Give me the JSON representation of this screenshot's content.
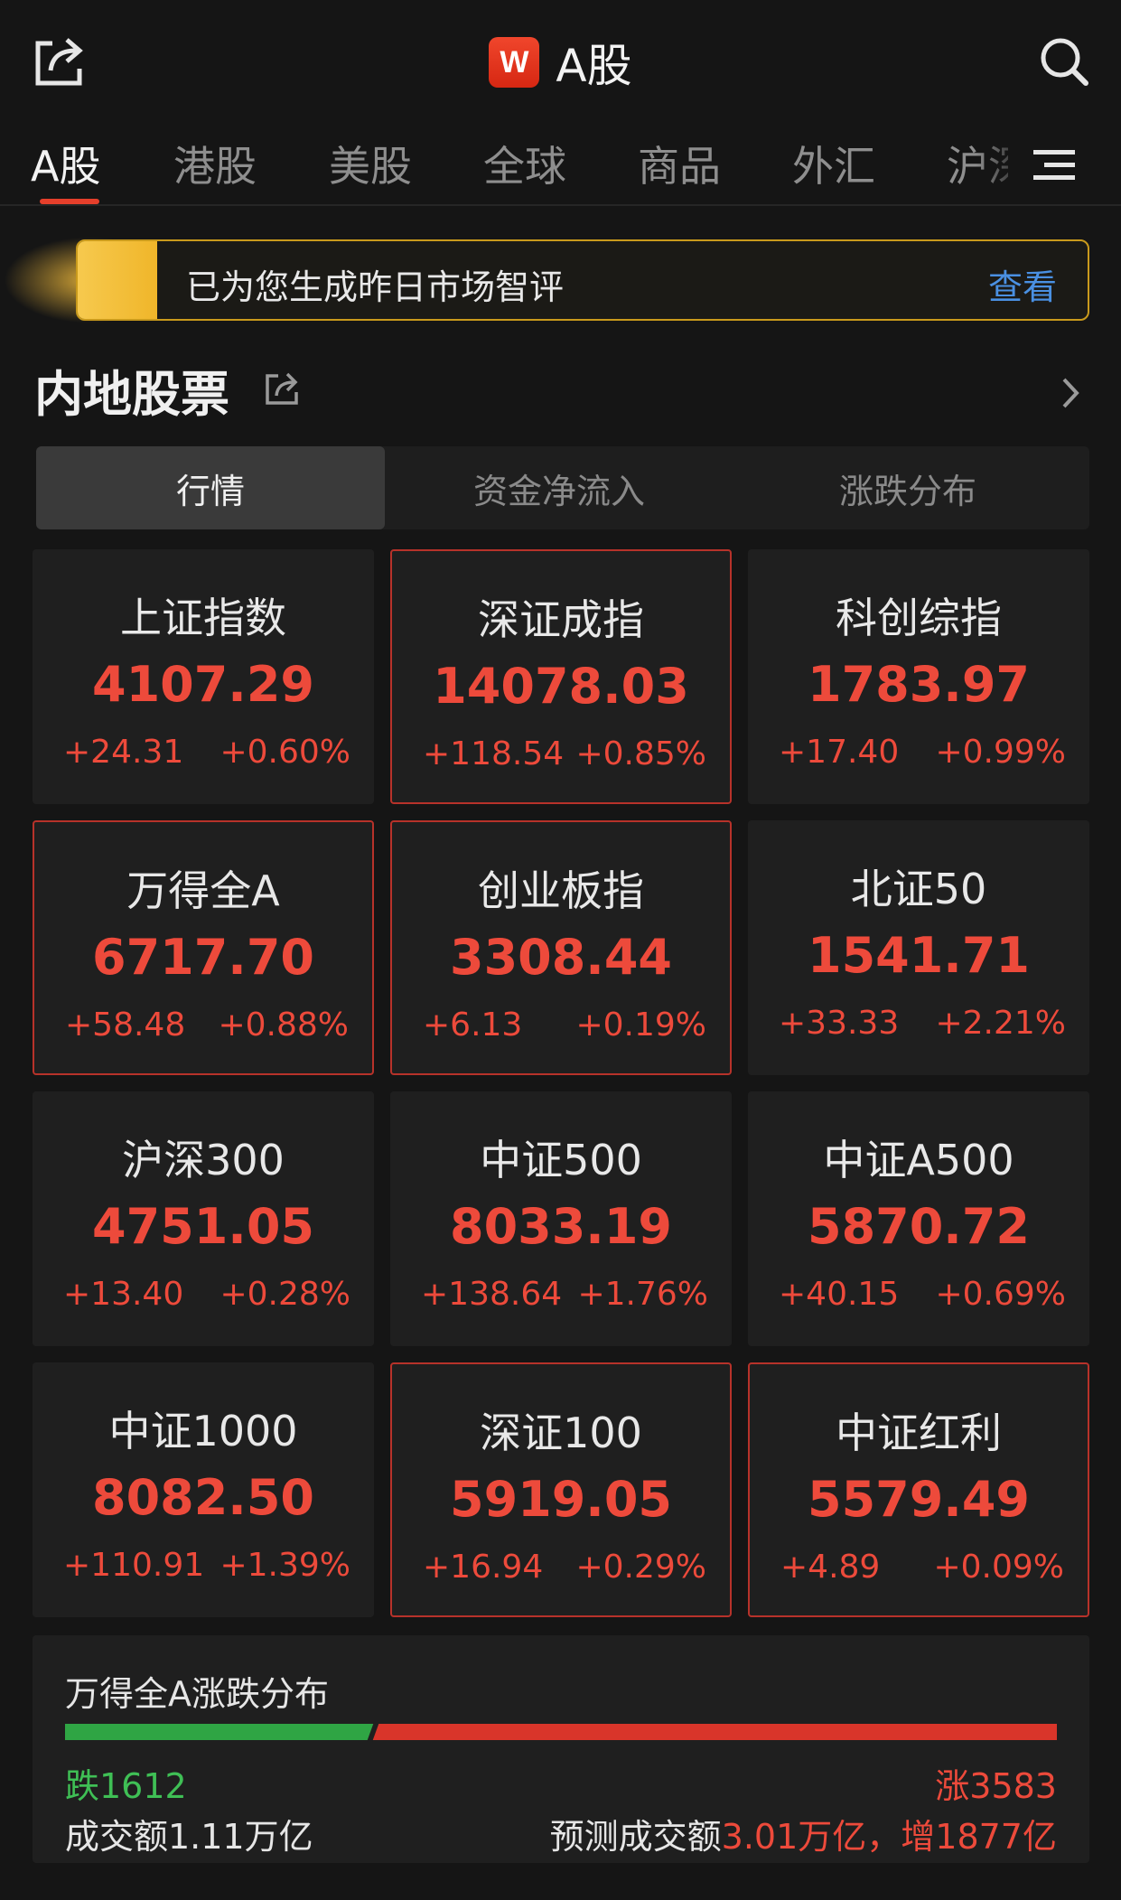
{
  "header": {
    "logo_letter": "W",
    "title": "A股",
    "icons": [
      "share-icon",
      "search-icon",
      "menu-icon"
    ]
  },
  "tabs": [
    {
      "label": "A股",
      "active": true
    },
    {
      "label": "港股",
      "active": false
    },
    {
      "label": "美股",
      "active": false
    },
    {
      "label": "全球",
      "active": false
    },
    {
      "label": "商品",
      "active": false
    },
    {
      "label": "外汇",
      "active": false
    },
    {
      "label": "沪深",
      "active": false
    }
  ],
  "banner": {
    "text": "已为您生成昨日市场智评",
    "link": "查看"
  },
  "section": {
    "title": "内地股票"
  },
  "subtabs": [
    {
      "label": "行情",
      "active": true
    },
    {
      "label": "资金净流入",
      "active": false
    },
    {
      "label": "涨跌分布",
      "active": false
    }
  ],
  "indices": [
    {
      "name": "上证指数",
      "value": "4107.29",
      "change": "+24.31",
      "pct": "+0.60%",
      "highlight": false
    },
    {
      "name": "深证成指",
      "value": "14078.03",
      "change": "+118.54",
      "pct": "+0.85%",
      "highlight": true
    },
    {
      "name": "科创综指",
      "value": "1783.97",
      "change": "+17.40",
      "pct": "+0.99%",
      "highlight": false
    },
    {
      "name": "万得全A",
      "value": "6717.70",
      "change": "+58.48",
      "pct": "+0.88%",
      "highlight": true
    },
    {
      "name": "创业板指",
      "value": "3308.44",
      "change": "+6.13",
      "pct": "+0.19%",
      "highlight": true
    },
    {
      "name": "北证50",
      "value": "1541.71",
      "change": "+33.33",
      "pct": "+2.21%",
      "highlight": false
    },
    {
      "name": "沪深300",
      "value": "4751.05",
      "change": "+13.40",
      "pct": "+0.28%",
      "highlight": false
    },
    {
      "name": "中证500",
      "value": "8033.19",
      "change": "+138.64",
      "pct": "+1.76%",
      "highlight": false
    },
    {
      "name": "中证A500",
      "value": "5870.72",
      "change": "+40.15",
      "pct": "+0.69%",
      "highlight": false
    },
    {
      "name": "中证1000",
      "value": "8082.50",
      "change": "+110.91",
      "pct": "+1.39%",
      "highlight": false
    },
    {
      "name": "深证100",
      "value": "5919.05",
      "change": "+16.94",
      "pct": "+0.29%",
      "highlight": true
    },
    {
      "name": "中证红利",
      "value": "5579.49",
      "change": "+4.89",
      "pct": "+0.09%",
      "highlight": true
    }
  ],
  "distribution": {
    "title": "万得全A涨跌分布",
    "down_label": "跌1612",
    "up_label": "涨3583",
    "down_count": 1612,
    "up_count": 3583,
    "volume": "成交额1.11万亿",
    "forecast_prefix": "预测成交额",
    "forecast_value": "3.01万亿，增1877亿",
    "colors": {
      "up": "#d9352a",
      "down": "#2fa544"
    }
  }
}
